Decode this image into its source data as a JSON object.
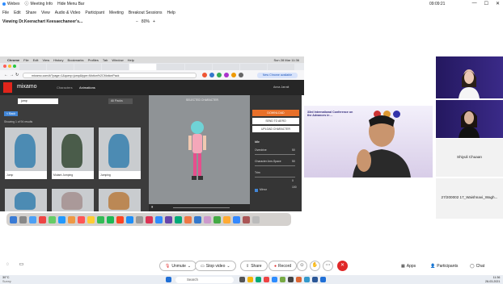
{
  "titlebar": {
    "app": "Webex",
    "meeting_info": "Meeting Info",
    "hide_menu": "Hide Menu Bar"
  },
  "menu": [
    "File",
    "Edit",
    "Share",
    "View",
    "Audio & Video",
    "Participant",
    "Meeting",
    "Breakout Sessions",
    "Help"
  ],
  "view": {
    "title": "Viewing Dr.Keerachart Keesaechaneer's...",
    "zoom": "80%"
  },
  "clock": "09:09:21",
  "browser": {
    "mac_menu": [
      "Chrome",
      "File",
      "Edit",
      "View",
      "History",
      "Bookmarks",
      "Profiles",
      "Tab",
      "Window",
      "Help"
    ],
    "mac_time": "Sun 28 Mar 11:36",
    "url": "mixamo.com/#/?page=1&query=jump&type=Motion%2CMotionPack",
    "update_button": "New Chrome available"
  },
  "mixamo": {
    "brand": "mixamo",
    "tabs": [
      "Characters",
      "Animations"
    ],
    "user": "Anna Jarrait",
    "search": "jump",
    "filter": "All Packs",
    "back": "< Back",
    "showing": "Showing 1 of 94 results",
    "selected_char": "SELECTED CHARACTER",
    "cards": [
      "Jump",
      "Mutant Jumping",
      "Jumping",
      "",
      "",
      ""
    ],
    "panel": {
      "download": "DOWNLOAD",
      "send": "SEND TO AERO",
      "upload": "UPLOAD CHARACTER",
      "idle": "Idle",
      "sliders": [
        {
          "label": "Overdrive",
          "value": "50"
        },
        {
          "label": "Character Arm-Space",
          "value": "50"
        },
        {
          "label": "Trim",
          "value": "0"
        },
        {
          "label": "",
          "value": "100"
        }
      ],
      "mirror": "Mirror"
    }
  },
  "participants": {
    "main_slide": "33rd International Conference on the Advances in ...",
    "tile_names": [
      "",
      "",
      "Shiyuli Chuaan",
      "27/200002 17_Waishnavi_Wagh..."
    ]
  },
  "controls": {
    "unmute": "Unmute",
    "stop_video": "Stop video",
    "share": "Share",
    "record": "Record",
    "apps": "Apps",
    "participants": "Participants",
    "chat": "Chat"
  },
  "taskbar": {
    "weather": "30°C",
    "weather_sub": "Sunny",
    "search": "Search",
    "time": "11:36",
    "date": "28-03-2021"
  }
}
